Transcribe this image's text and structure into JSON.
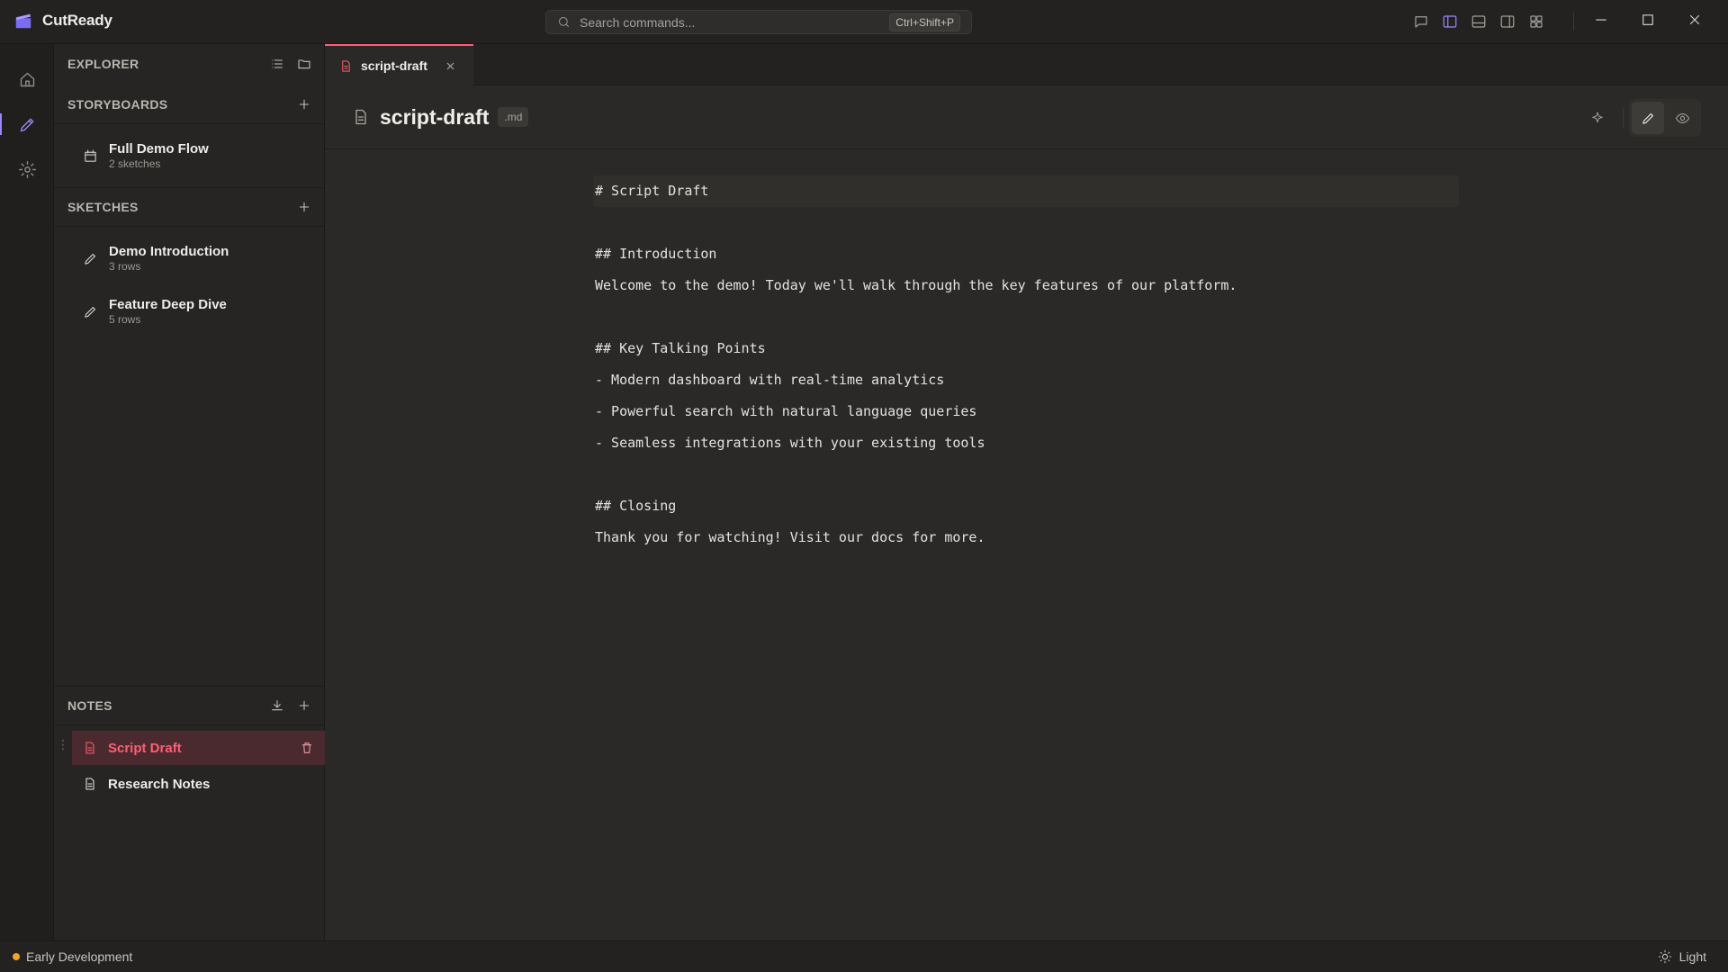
{
  "app": {
    "name": "CutReady"
  },
  "search": {
    "placeholder": "Search commands...",
    "shortcut": "Ctrl+Shift+P"
  },
  "titlebar_icons": [
    "chat-icon",
    "sidebar-left-icon",
    "panel-bottom-icon",
    "sidebar-right-icon",
    "grid-layout-icon"
  ],
  "window_controls": [
    "minimize-icon",
    "maximize-icon",
    "close-icon"
  ],
  "activity": [
    "home-icon",
    "pencil-icon",
    "gear-icon"
  ],
  "sidebar": {
    "explorer": {
      "title": "EXPLORER"
    },
    "storyboards": {
      "title": "STORYBOARDS",
      "items": [
        {
          "title": "Full Demo Flow",
          "sub": "2 sketches",
          "icon": "calendar-icon"
        }
      ]
    },
    "sketches": {
      "title": "SKETCHES",
      "items": [
        {
          "title": "Demo Introduction",
          "sub": "3 rows",
          "icon": "pencil-icon"
        },
        {
          "title": "Feature Deep Dive",
          "sub": "5 rows",
          "icon": "pencil-icon"
        }
      ]
    },
    "notes": {
      "title": "NOTES",
      "items": [
        {
          "title": "Script Draft",
          "active": true,
          "icon": "document-icon"
        },
        {
          "title": "Research Notes",
          "active": false,
          "icon": "document-icon"
        }
      ]
    }
  },
  "tabs": [
    {
      "label": "script-draft",
      "active": true
    }
  ],
  "editor": {
    "title": "script-draft",
    "ext": ".md",
    "lines": [
      "# Script Draft",
      "",
      "## Introduction",
      "Welcome to the demo! Today we'll walk through the key features of our platform.",
      "",
      "## Key Talking Points",
      "- Modern dashboard with real-time analytics",
      "- Powerful search with natural language queries",
      "- Seamless integrations with your existing tools",
      "",
      "## Closing",
      "Thank you for watching! Visit our docs for more."
    ]
  },
  "status": {
    "left": "Early Development",
    "theme": "Light"
  },
  "colors": {
    "accent": "#9b87f5",
    "active_note": "#ff5f72",
    "status_dot": "#f5a524"
  }
}
